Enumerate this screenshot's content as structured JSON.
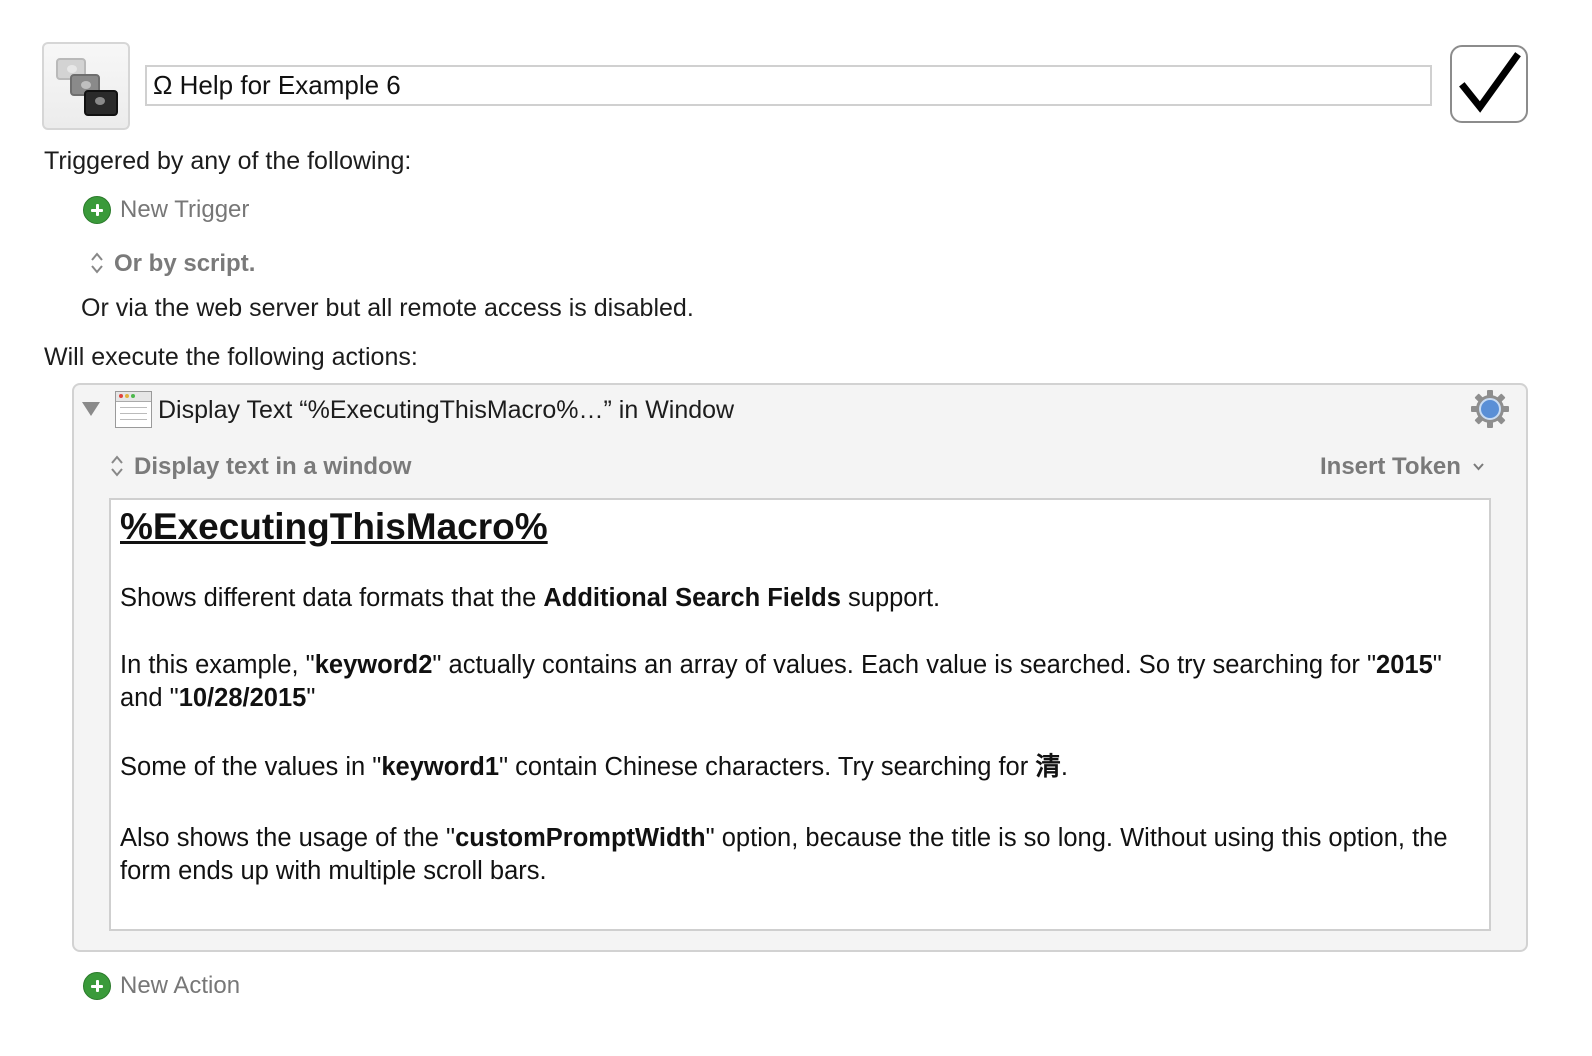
{
  "macro": {
    "title": "Ω Help for Example 6",
    "enabled": true
  },
  "triggers": {
    "heading": "Triggered by any of the following:",
    "new_trigger_label": "New Trigger",
    "or_by_script_label": "Or by script.",
    "web_server_note": "Or via the web server but all remote access is disabled."
  },
  "actions": {
    "heading": "Will execute the following actions:",
    "new_action_label": "New Action",
    "items": [
      {
        "title": "Display Text “%ExecutingThisMacro%…” in Window",
        "mode_label": "Display text in a window",
        "insert_token_label": "Insert Token",
        "content": {
          "heading": "%ExecutingThisMacro%",
          "p1_a": "Shows different data formats that the ",
          "p1_b": "Additional Search Fields",
          "p1_c": " support.",
          "p2_a": "In this example, \"",
          "p2_b": "keyword2",
          "p2_c": "\" actually contains an array of values. Each value is searched. So try searching for \"",
          "p2_d": "2015",
          "p2_e": "\" and \"",
          "p2_f": "10/28/2015",
          "p2_g": "\"",
          "p3_a": "Some of the values in \"",
          "p3_b": "keyword1",
          "p3_c": "\" contain Chinese characters. Try searching for ",
          "p3_d": "清",
          "p3_e": ".",
          "p4_a": "Also shows the usage of the \"",
          "p4_b": "customPromptWidth",
          "p4_c": "\" option, because the title is so long. Without using this option, the form ends up with multiple scroll bars."
        }
      }
    ]
  },
  "icons": {
    "macro_icon": "stacked-windows-icon",
    "enabled_icon": "checkmark-icon",
    "add_icon": "plus-circle-icon",
    "popup_icon": "up-down-chevron-icon",
    "disclosure_icon": "disclosure-triangle-icon",
    "action_icon": "window-icon",
    "settings_icon": "gear-icon"
  },
  "colors": {
    "add_green": "#3a9a3a",
    "gear_blue": "#5a8fd6"
  }
}
